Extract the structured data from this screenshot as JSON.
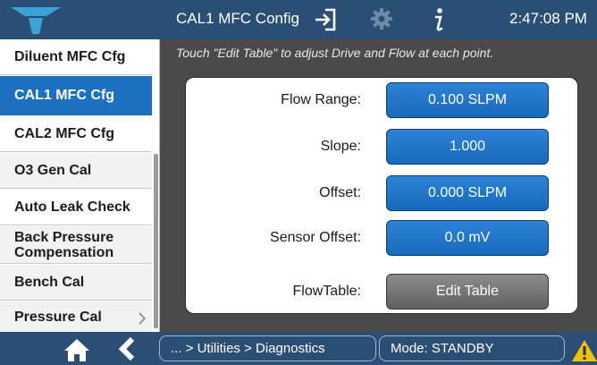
{
  "header": {
    "title": "CAL1 MFC Config",
    "time": "2:47:08 PM"
  },
  "sidebar": {
    "items": [
      {
        "label": "Diluent MFC Cfg"
      },
      {
        "label": "CAL1 MFC Cfg"
      },
      {
        "label": "CAL2 MFC Cfg"
      },
      {
        "label": "O3 Gen Cal"
      },
      {
        "label": "Auto Leak Check"
      },
      {
        "label": "Back Pressure Compensation"
      },
      {
        "label": "Bench Cal"
      },
      {
        "label": "Pressure Cal"
      }
    ],
    "active_index": 1
  },
  "main": {
    "instruction": "Touch \"Edit Table\" to adjust Drive and Flow at each point.",
    "fields": [
      {
        "label": "Flow Range:",
        "value": "0.100 SLPM"
      },
      {
        "label": "Slope:",
        "value": "1.000"
      },
      {
        "label": "Offset:",
        "value": "0.000 SLPM"
      },
      {
        "label": "Sensor Offset:",
        "value": "0.0 mV"
      },
      {
        "label": "FlowTable:",
        "value": "Edit Table"
      }
    ]
  },
  "footer": {
    "breadcrumb": "... > Utilities > Diagnostics",
    "mode": "Mode: STANDBY"
  },
  "colors": {
    "header_bg": "#2b4f74",
    "accent_blue": "#1d6fc0",
    "warning": "#f2c200"
  },
  "icons": [
    "logo-icon",
    "exit-icon",
    "gear-icon",
    "info-icon",
    "home-icon",
    "back-icon",
    "warning-icon",
    "chevron-right-icon"
  ]
}
